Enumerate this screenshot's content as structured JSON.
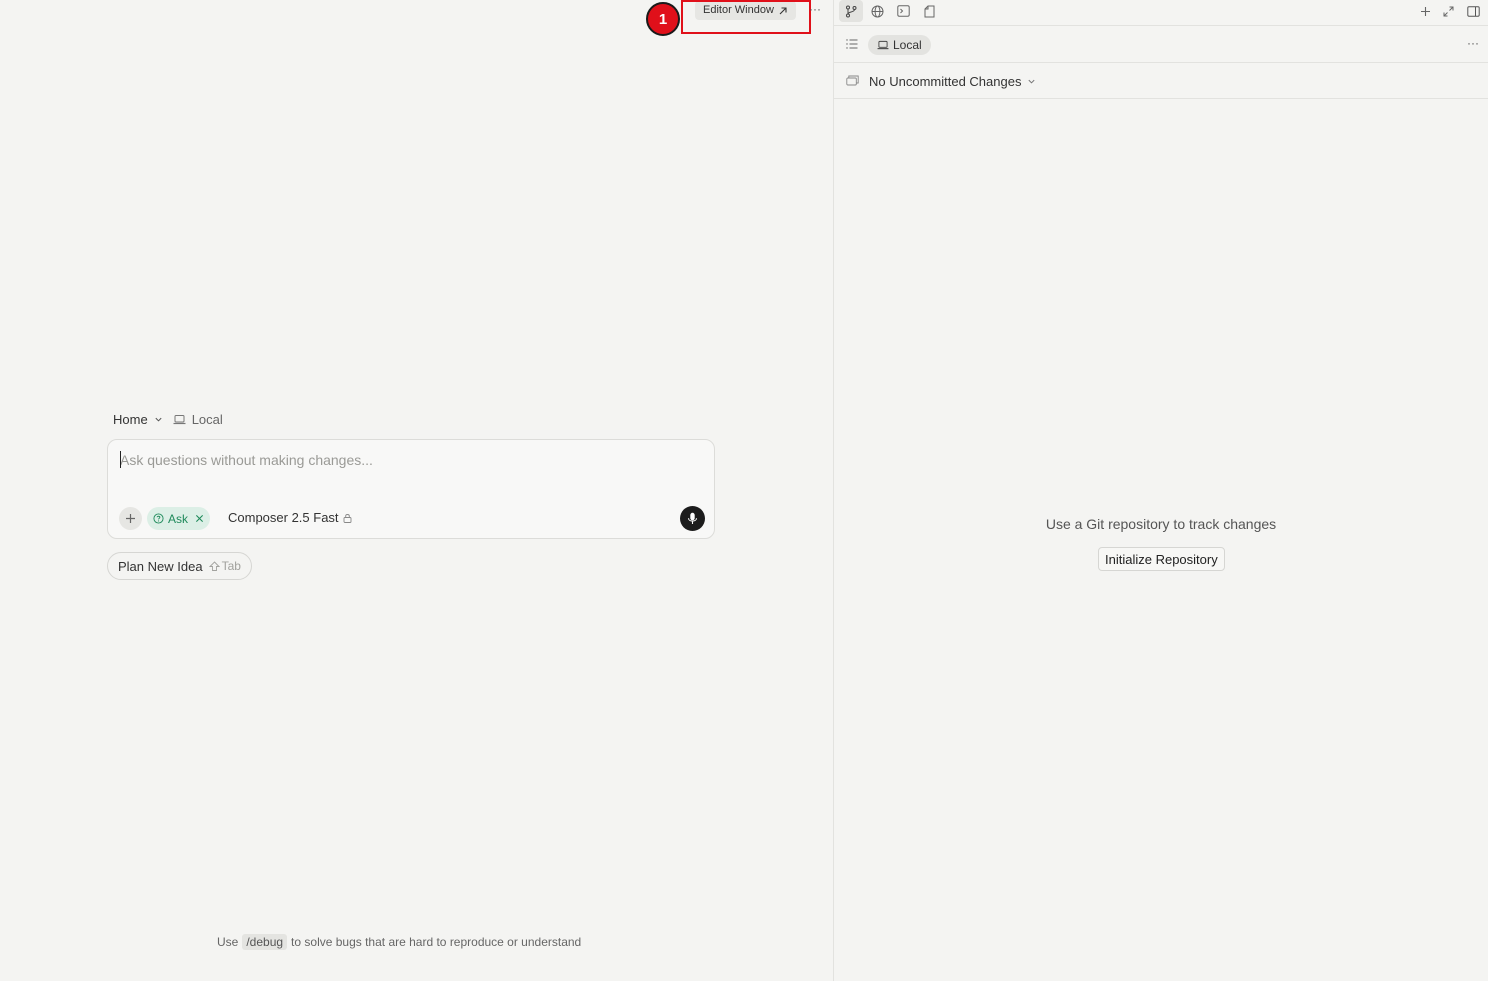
{
  "top_bar": {
    "editor_window_label": "Editor Window",
    "more_label": "···",
    "annotation_step": "1"
  },
  "composer": {
    "breadcrumb_home": "Home",
    "breadcrumb_location": "Local",
    "input_placeholder": "Ask questions without making changes...",
    "mode_chip": "Ask",
    "model_name": "Composer 2.5 Fast",
    "plan_button_label": "Plan New Idea",
    "plan_button_hint": "Tab"
  },
  "tip": {
    "prefix": "Use",
    "command": "/debug",
    "suffix": "to solve bugs that are hard to reproduce or understand"
  },
  "right_panel": {
    "location_chip": "Local",
    "more_label": "···",
    "changes_label": "No Uncommitted Changes",
    "empty_message": "Use a Git repository to track changes",
    "init_button_label": "Initialize Repository"
  },
  "colors": {
    "accent_red": "#e0101a",
    "ask_green": "#1f8a5b",
    "background": "#f4f4f2"
  }
}
